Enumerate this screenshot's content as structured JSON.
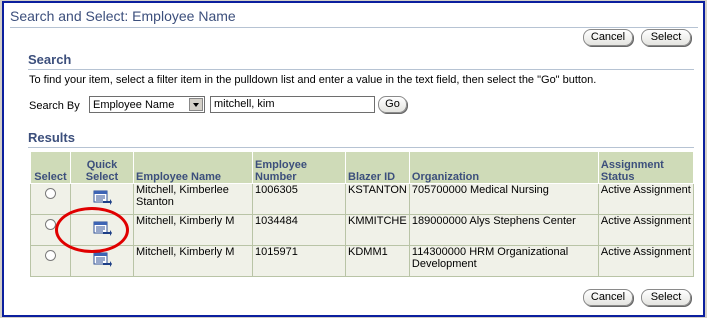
{
  "window": {
    "title": "Search and Select: Employee Name"
  },
  "toolbar": {
    "cancel_label": "Cancel",
    "select_label": "Select"
  },
  "search": {
    "heading": "Search",
    "instructions": "To find your item, select a filter item in the pulldown list and enter a value in the text field, then select the \"Go\" button.",
    "search_by_label": "Search By",
    "filter_value": "Employee Name",
    "query_value": "mitchell, kim",
    "go_label": "Go"
  },
  "results": {
    "heading": "Results",
    "columns": {
      "select": "Select",
      "quick_select": "Quick Select",
      "employee_name": "Employee Name",
      "employee_number": "Employee Number",
      "blazer_id": "Blazer ID",
      "organization": "Organization",
      "assignment_status": "Assignment Status"
    },
    "rows": [
      {
        "employee_name": "Mitchell, Kimberlee Stanton",
        "employee_number": "1006305",
        "blazer_id": "KSTANTON",
        "organization": "705700000 Medical Nursing",
        "assignment_status": "Active Assignment"
      },
      {
        "employee_name": "Mitchell, Kimberly M",
        "employee_number": "1034484",
        "blazer_id": "KMMITCHE",
        "organization": "189000000 Alys Stephens Center",
        "assignment_status": "Active Assignment"
      },
      {
        "employee_name": "Mitchell, Kimberly M",
        "employee_number": "1015971",
        "blazer_id": "KDMM1",
        "organization": "114300000 HRM Organizational Development",
        "assignment_status": "Active Assignment"
      }
    ]
  },
  "icons": {
    "quick_select": "quick-select-icon"
  },
  "colors": {
    "heading": "#3c4f7c",
    "table_header": "#cfdbb8",
    "table_cell": "#f0f1e8",
    "highlight": "#e00000"
  }
}
